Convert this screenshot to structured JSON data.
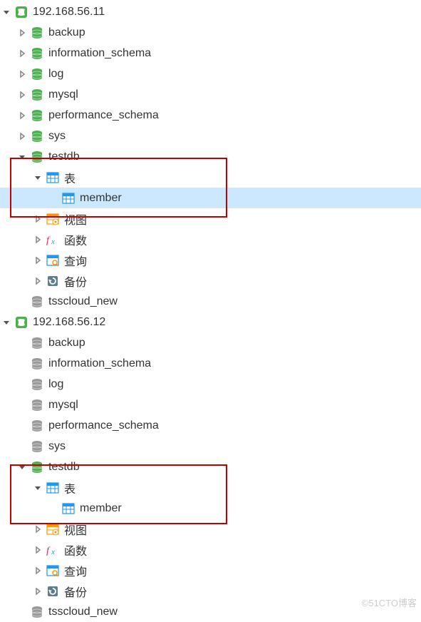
{
  "watermark": "©51CTO博客",
  "connections": [
    {
      "name": "192.168.56.11",
      "expanded": true,
      "active": true,
      "databases": [
        {
          "name": "backup",
          "expanded": false,
          "expandable": true,
          "active": true
        },
        {
          "name": "information_schema",
          "expanded": false,
          "expandable": true,
          "active": true
        },
        {
          "name": "log",
          "expanded": false,
          "expandable": true,
          "active": true
        },
        {
          "name": "mysql",
          "expanded": false,
          "expandable": true,
          "active": true
        },
        {
          "name": "performance_schema",
          "expanded": false,
          "expandable": true,
          "active": true
        },
        {
          "name": "sys",
          "expanded": false,
          "expandable": true,
          "active": true
        },
        {
          "name": "testdb",
          "expanded": true,
          "expandable": true,
          "active": true,
          "children": [
            {
              "type": "tables",
              "label": "表",
              "expanded": true,
              "items": [
                "member"
              ],
              "selected_item": "member"
            },
            {
              "type": "views",
              "label": "视图"
            },
            {
              "type": "functions",
              "label": "函数"
            },
            {
              "type": "queries",
              "label": "查询"
            },
            {
              "type": "backups",
              "label": "备份"
            }
          ]
        },
        {
          "name": "tsscloud_new",
          "expanded": false,
          "expandable": false,
          "active": false
        }
      ]
    },
    {
      "name": "192.168.56.12",
      "expanded": true,
      "active": true,
      "databases": [
        {
          "name": "backup",
          "expanded": false,
          "expandable": false,
          "active": false
        },
        {
          "name": "information_schema",
          "expanded": false,
          "expandable": false,
          "active": false
        },
        {
          "name": "log",
          "expanded": false,
          "expandable": false,
          "active": false
        },
        {
          "name": "mysql",
          "expanded": false,
          "expandable": false,
          "active": false
        },
        {
          "name": "performance_schema",
          "expanded": false,
          "expandable": false,
          "active": false
        },
        {
          "name": "sys",
          "expanded": false,
          "expandable": false,
          "active": false
        },
        {
          "name": "testdb",
          "expanded": true,
          "expandable": true,
          "active": true,
          "children": [
            {
              "type": "tables",
              "label": "表",
              "expanded": true,
              "items": [
                "member"
              ]
            },
            {
              "type": "views",
              "label": "视图"
            },
            {
              "type": "functions",
              "label": "函数"
            },
            {
              "type": "queries",
              "label": "查询"
            },
            {
              "type": "backups",
              "label": "备份"
            }
          ]
        },
        {
          "name": "tsscloud_new",
          "expanded": false,
          "expandable": false,
          "active": false
        }
      ]
    }
  ]
}
